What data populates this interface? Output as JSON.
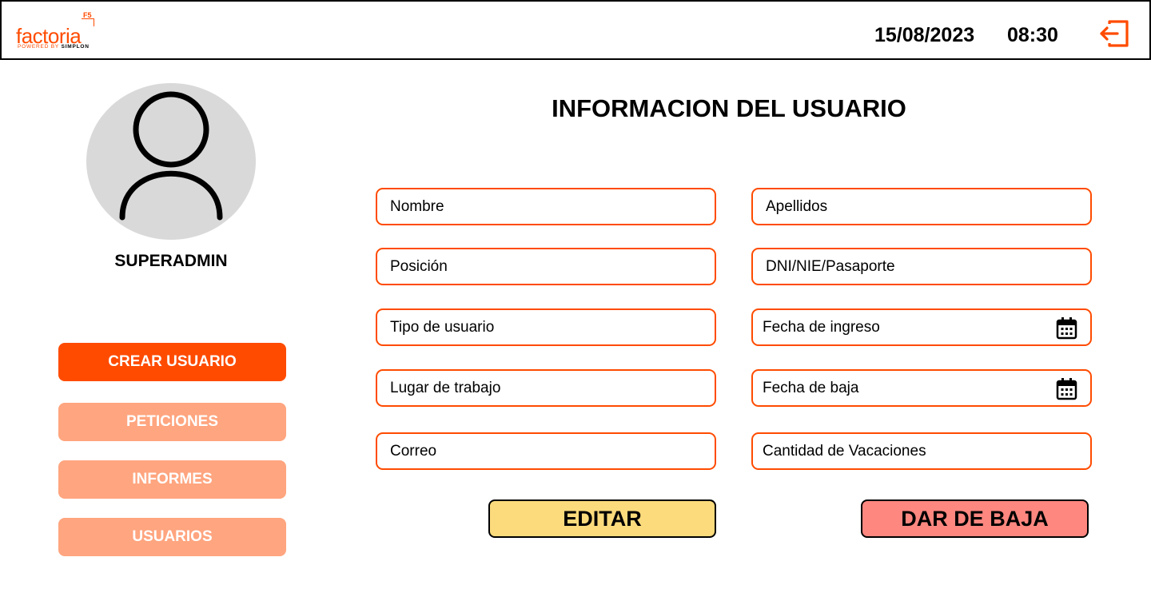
{
  "header": {
    "logo": {
      "word": "factoria",
      "badge": "F5",
      "tagline_prefix": "POWERED BY ",
      "tagline_brand": "SIMPLON"
    },
    "date": "15/08/2023",
    "time": "08:30",
    "logout_icon": "logout-icon"
  },
  "sidebar": {
    "avatar_icon": "user-icon",
    "username": "SUPERADMIN",
    "buttons": [
      {
        "label": "CREAR USUARIO",
        "active": true
      },
      {
        "label": "PETICIONES",
        "active": false
      },
      {
        "label": "INFORMES",
        "active": false
      },
      {
        "label": "USUARIOS",
        "active": false
      }
    ]
  },
  "main": {
    "title": "INFORMACION DEL USUARIO",
    "fields_left": [
      {
        "label": "Nombre"
      },
      {
        "label": "Posición"
      },
      {
        "label": "Tipo de usuario"
      },
      {
        "label": "Lugar de trabajo"
      },
      {
        "label": "Correo"
      }
    ],
    "fields_right": [
      {
        "label": "Apellidos"
      },
      {
        "label": "DNI/NIE/Pasaporte"
      },
      {
        "label": "Fecha de ingreso",
        "icon": "calendar-icon"
      },
      {
        "label": "Fecha de baja",
        "icon": "calendar-icon"
      },
      {
        "label": "Cantidad de Vacaciones"
      }
    ],
    "edit_label": "EDITAR",
    "deactivate_label": "DAR DE BAJA"
  },
  "colors": {
    "accent": "#ff4b00",
    "accent_light": "#ffa57f",
    "edit": "#fbdb7c",
    "deactivate": "#fe8780",
    "avatar_bg": "#d9d9d9"
  }
}
